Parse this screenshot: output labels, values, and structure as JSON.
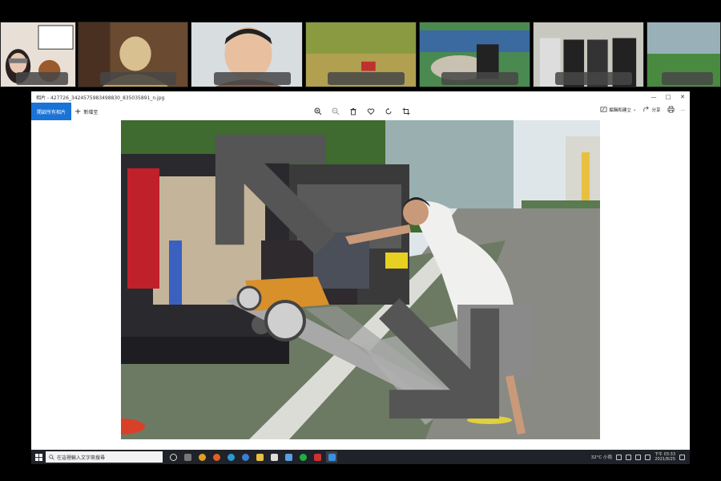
{
  "meeting": {
    "participants": [
      {
        "id": "p1",
        "icon": "participant-video"
      },
      {
        "id": "p2",
        "icon": "participant-video"
      },
      {
        "id": "p3",
        "icon": "participant-video"
      },
      {
        "id": "p4",
        "icon": "participant-video"
      },
      {
        "id": "p5",
        "icon": "participant-video"
      },
      {
        "id": "p6",
        "icon": "participant-video"
      },
      {
        "id": "p7",
        "icon": "participant-video"
      }
    ]
  },
  "viewer": {
    "title": "相片 - 427726_3424575983498830_835035891_n.jpg",
    "window_controls": [
      "—",
      "□",
      "✕"
    ],
    "open_app_label": "開啟所有相片",
    "add_album_label": "新增至",
    "edit_label": "編輯和建立",
    "share_label": "分享",
    "more_label": "…",
    "image_icon": "photo-of-man-loading-wheelchair-via-ramp"
  },
  "taskbar": {
    "search_placeholder": "在這裡輸入文字來搜尋",
    "weather": "32°C 小雨",
    "time": "下午 03:33",
    "date": "2021/8/25",
    "accent": "#1a73d6"
  }
}
